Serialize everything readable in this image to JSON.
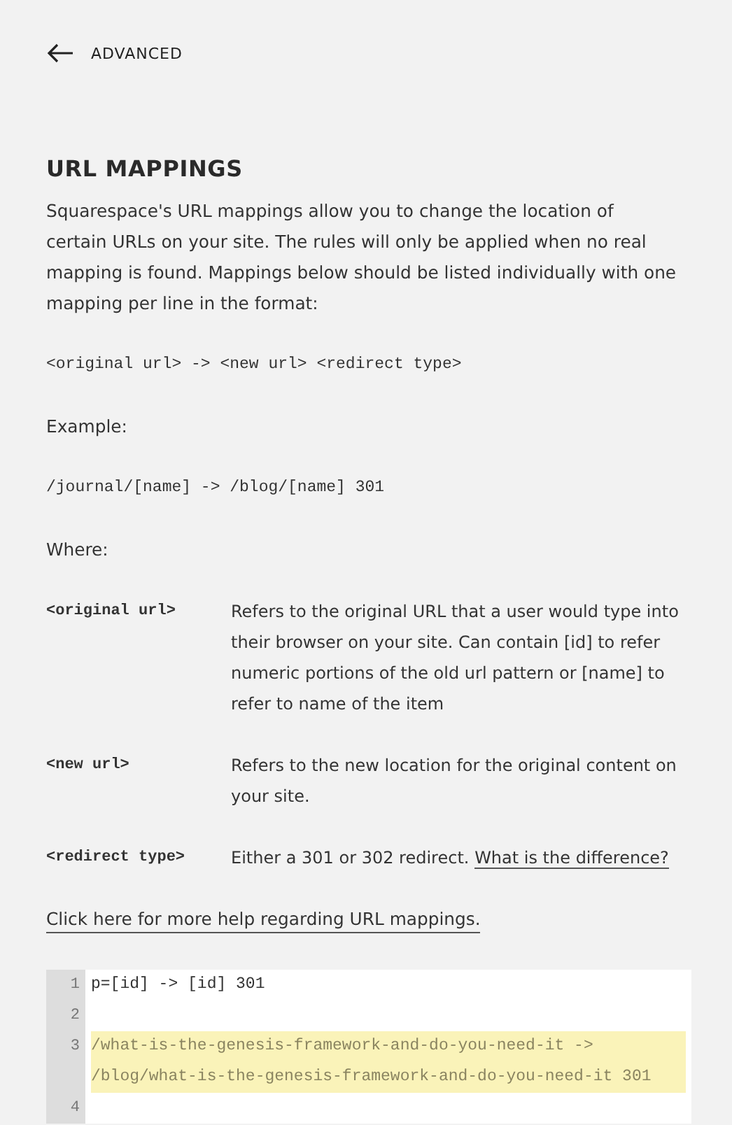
{
  "back": {
    "label": "ADVANCED"
  },
  "title": "URL MAPPINGS",
  "intro": "Squarespace's URL mappings allow you to change the location of certain URLs on your site. The rules will only be applied when no real mapping is found. Mappings below should be listed individually with one mapping per line in the format:",
  "format": "<original url> -> <new url> <redirect type>",
  "example_label": "Example:",
  "example": "/journal/[name] -> /blog/[name] 301",
  "where_label": "Where:",
  "definitions": [
    {
      "term": "<original url>",
      "description": "Refers to the original URL that a user would type into their browser on your site. Can contain [id] to refer numeric portions of the old url pattern or [name] to refer to name of the item"
    },
    {
      "term": "<new url>",
      "description": "Refers to the new location for the original content on your site."
    },
    {
      "term": "<redirect type>",
      "description": "Either a 301 or 302 redirect.",
      "link": "What is the difference?"
    }
  ],
  "help_link": "Click here for more help regarding URL mappings.",
  "editor": {
    "lines": [
      {
        "number": "1",
        "text": "p=[id] -> [id] 301",
        "highlighted": false
      },
      {
        "number": "2",
        "highlighted": false
      },
      {
        "number": "3",
        "text": "/what-is-the-genesis-framework-and-do-you-need-it -> /blog/what-is-the-genesis-framework-and-do-you-need-it 301",
        "highlighted": true
      },
      {
        "number": "4",
        "highlighted": false
      }
    ]
  }
}
